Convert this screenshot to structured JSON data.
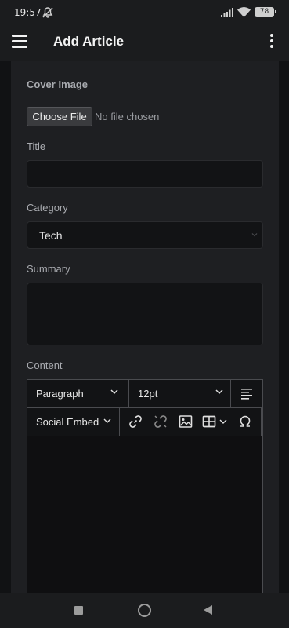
{
  "status": {
    "time": "19:57",
    "battery": "78"
  },
  "appbar": {
    "title": "Add Article"
  },
  "form": {
    "cover_label": "Cover Image",
    "file_button": "Choose File",
    "file_status": "No file chosen",
    "title_label": "Title",
    "title_value": "",
    "category_label": "Category",
    "category_value": "Tech",
    "summary_label": "Summary",
    "summary_value": "",
    "content_label": "Content"
  },
  "editor": {
    "block_format": "Paragraph",
    "font_size": "12pt",
    "social_embed": "Social Embed",
    "toolbar_icons": [
      "align-left-icon",
      "link-icon",
      "unlink-icon",
      "image-icon",
      "table-icon",
      "special-character-icon"
    ],
    "body": ""
  },
  "colors": {
    "background": "#111214",
    "card": "#1e1f22",
    "input": "#121315",
    "border": "#4a4b4f"
  }
}
